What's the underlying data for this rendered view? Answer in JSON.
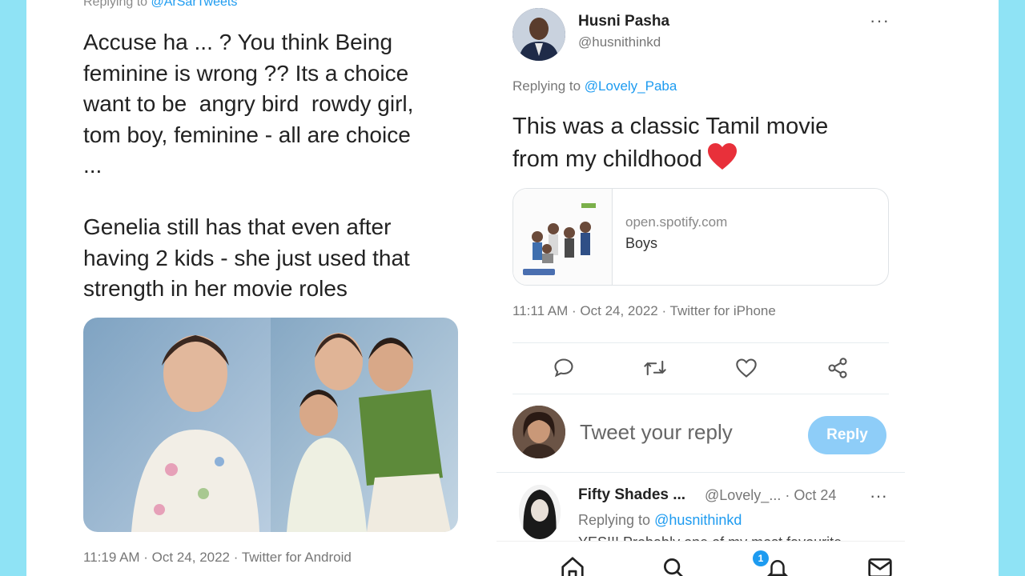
{
  "left_tweet": {
    "replying_prefix": "Replying to ",
    "replying_handle": "@ArSarTweets",
    "text": "Accuse ha ... ? You think Being\nfeminine is wrong ?? Its a choice\nwant to be  angry bird  rowdy girl,\ntom boy, feminine - all are choice\n...\n\nGenelia still has that even after\nhaving 2 kids - she just used that\nstrength in her movie roles",
    "meta": "11:19 AM · Oct 24, 2022 · Twitter for Android"
  },
  "right_tweet": {
    "author_name": "Husni Pasha",
    "author_handle": "@husnithinkd",
    "more": "···",
    "replying_prefix": "Replying to ",
    "replying_handle": "@Lovely_Paba",
    "text": "This was a classic Tamil movie from my childhood",
    "card": {
      "domain": "open.spotify.com",
      "title": "Boys"
    },
    "meta": "11:11 AM · Oct 24, 2022 · Twitter for iPhone",
    "actions": [
      "reply-icon",
      "retweet-icon",
      "like-icon",
      "share-icon"
    ]
  },
  "compose": {
    "placeholder": "Tweet your reply",
    "button": "Reply"
  },
  "reply": {
    "name": "Fifty Shades ...",
    "meta": "@Lovely_... · Oct 24",
    "more": "···",
    "replying_prefix": "Replying to ",
    "replying_handle": "@husnithinkd",
    "text": "YES!!! Probably one of my most favourite"
  },
  "nav": {
    "items": [
      "home-icon",
      "search-icon",
      "notifications-icon",
      "messages-icon"
    ],
    "badge": "1"
  },
  "colors": {
    "accent": "#1d9bf0",
    "heart": "#e8303a",
    "page_bg": "#8fe3f5"
  }
}
